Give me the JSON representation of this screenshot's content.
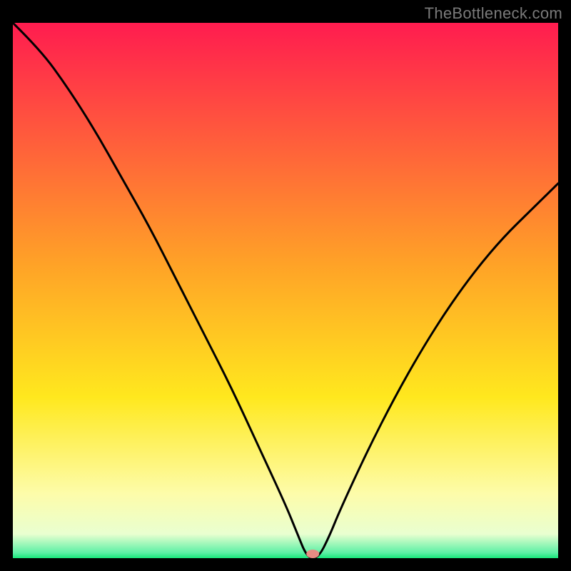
{
  "watermark": "TheBottleneck.com",
  "chart_data": {
    "type": "line",
    "title": "",
    "xlabel": "",
    "ylabel": "",
    "xlim": [
      0,
      100
    ],
    "ylim": [
      0,
      100
    ],
    "minimum_marker": {
      "x": 55,
      "y": 0,
      "color": "#e98c84"
    },
    "background_gradient": {
      "stops": [
        {
          "offset": 0.0,
          "color": "#ff1c4f"
        },
        {
          "offset": 0.45,
          "color": "#ffa227"
        },
        {
          "offset": 0.7,
          "color": "#ffe81e"
        },
        {
          "offset": 0.88,
          "color": "#fdfcaa"
        },
        {
          "offset": 0.955,
          "color": "#e9ffd0"
        },
        {
          "offset": 0.99,
          "color": "#5cf0a5"
        },
        {
          "offset": 1.0,
          "color": "#17e67a"
        }
      ]
    },
    "series": [
      {
        "name": "bottleneck-curve",
        "x": [
          0,
          5,
          10,
          15,
          20,
          25,
          30,
          35,
          40,
          45,
          50,
          52,
          54,
          56,
          58,
          60,
          65,
          70,
          75,
          80,
          85,
          90,
          95,
          100
        ],
        "values": [
          100,
          95,
          88,
          80,
          71,
          62,
          52,
          42,
          32,
          21,
          10,
          5,
          0,
          0,
          4,
          9,
          20,
          30,
          39,
          47,
          54,
          60,
          65,
          70
        ]
      }
    ]
  }
}
